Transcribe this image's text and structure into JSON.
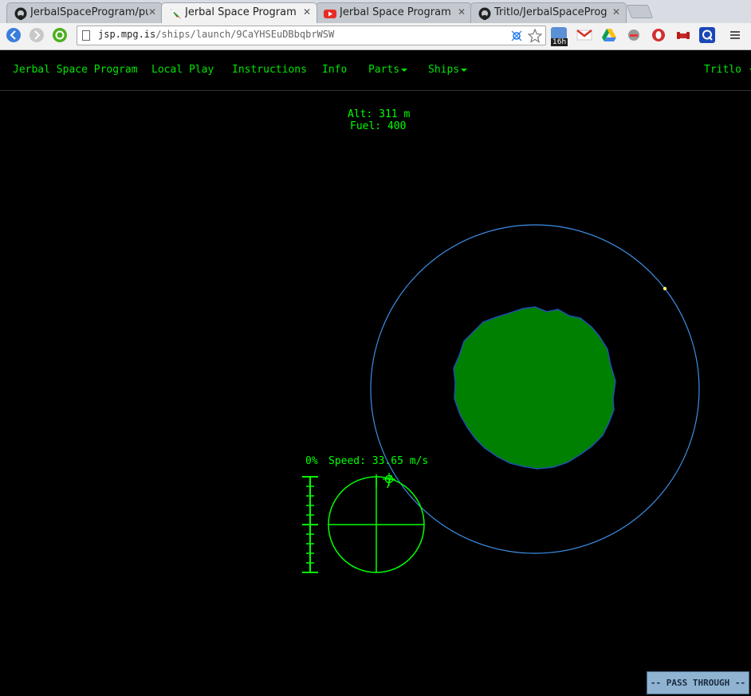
{
  "browser": {
    "tabs": [
      {
        "title": "JerbalSpaceProgram/pu",
        "icon": "github-icon",
        "active": false
      },
      {
        "title": "Jerbal Space Program",
        "icon": "rocket-icon",
        "active": true
      },
      {
        "title": "Jerbal Space Program A",
        "icon": "youtube-icon",
        "active": false
      },
      {
        "title": "Tritlo/JerbalSpacePrograi",
        "icon": "github-icon",
        "active": false
      }
    ],
    "url_host": "jsp.mpg.is",
    "url_path": "/ships/launch/9CaYHSEuDBbqbrWSW",
    "extension_badge": "16h"
  },
  "navbar": {
    "brand": "Jerbal Space Program",
    "items": [
      "Local Play",
      "Instructions",
      "Info"
    ],
    "dropdowns": [
      "Parts",
      "Ships"
    ],
    "user": "Tritlo"
  },
  "hud": {
    "altitude": "Alt: 311 m",
    "fuel": "Fuel: 400",
    "throttle": "0%",
    "speed": "Speed: 33.65 m/s"
  },
  "pass_through": "-- PASS THROUGH --",
  "colors": {
    "hud_green": "#00ff00",
    "planet_green": "#008000",
    "orbit_blue": "#3d8fe6",
    "button_blue": "#8fb3d1"
  }
}
